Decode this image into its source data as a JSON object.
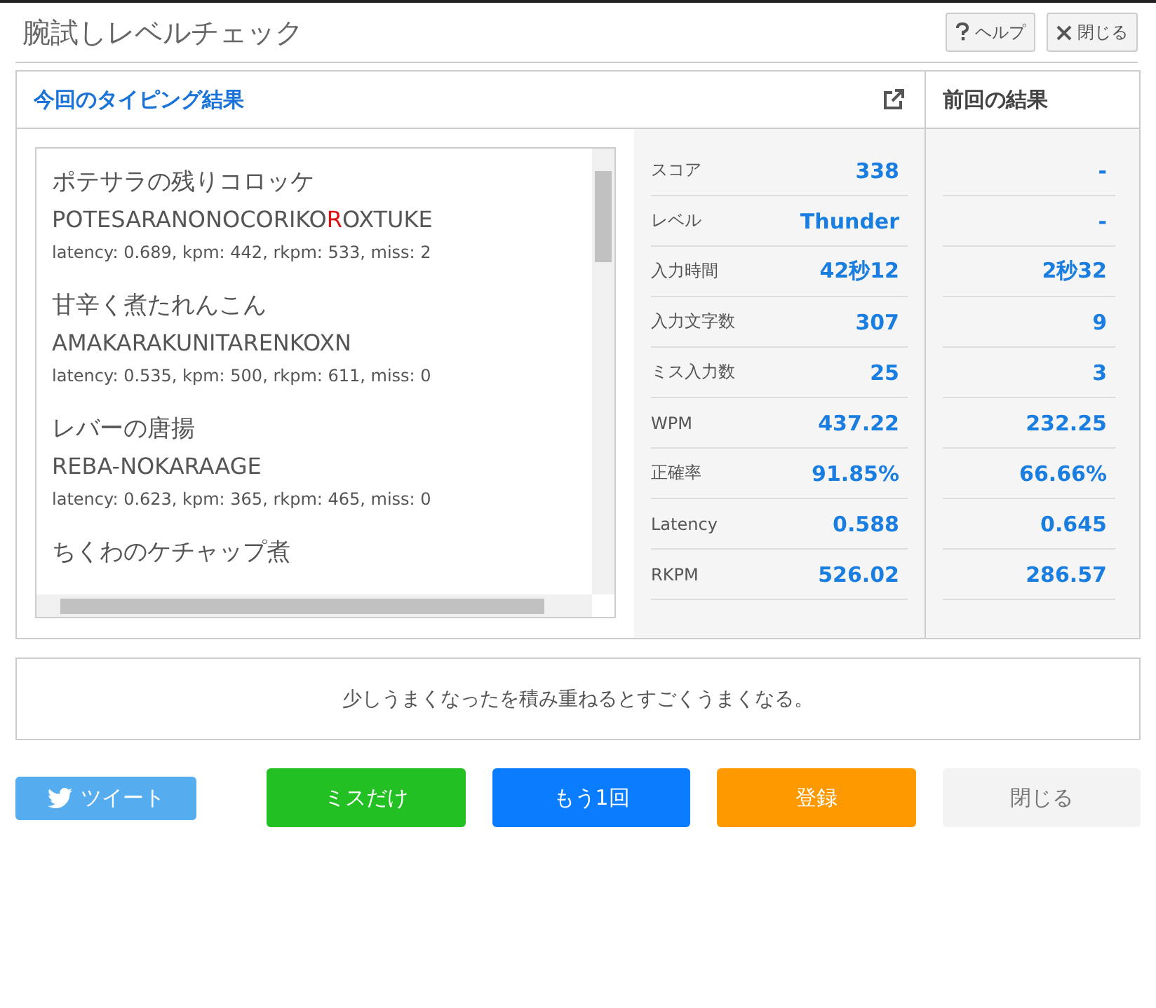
{
  "window": {
    "title": "腕試しレベルチェック",
    "buttons": [
      {
        "kind": "help",
        "label": "ヘルプ"
      },
      {
        "kind": "close",
        "label": "閉じる"
      }
    ]
  },
  "current": {
    "title": "今回のタイピング結果",
    "words": [
      {
        "title": "ポテサラの残りコロッケ",
        "romaji": [
          {
            "text": "POTESARANONOCORIKO",
            "miss": false
          },
          {
            "text": "R",
            "miss": true
          },
          {
            "text": "OXTUKE",
            "miss": false
          }
        ],
        "stats": "latency: 0.689, kpm: 442, rkpm: 533, miss: 2"
      },
      {
        "title": "甘辛く煮たれんこん",
        "romaji": [
          {
            "text": "AMAKARAKUNITARENKOXN",
            "miss": false
          }
        ],
        "stats": "latency: 0.535, kpm: 500, rkpm: 611, miss: 0"
      },
      {
        "title": "レバーの唐揚",
        "romaji": [
          {
            "text": "REBA-NOKARAAGE",
            "miss": false
          }
        ],
        "stats": "latency: 0.623, kpm: 365, rkpm: 465, miss: 0"
      },
      {
        "title": "ちくわのケチャップ煮"
      }
    ],
    "stats": [
      {
        "label": "スコア",
        "value": "338"
      },
      {
        "label": "レベル",
        "value": "Thunder"
      },
      {
        "label": "入力時間",
        "value": "42秒12"
      },
      {
        "label": "入力文字数",
        "value": "307"
      },
      {
        "label": "ミス入力数",
        "value": "25"
      },
      {
        "label": "WPM",
        "value": "437.22"
      },
      {
        "label": "正確率",
        "value": "91.85%"
      },
      {
        "label": "Latency",
        "value": "0.588"
      },
      {
        "label": "RKPM",
        "value": "526.02"
      }
    ]
  },
  "previous": {
    "title": "前回の結果",
    "values": [
      "-",
      "-",
      "2秒32",
      "9",
      "3",
      "232.25",
      "66.66%",
      "0.645",
      "286.57"
    ]
  },
  "message": "少しうまくなったを積み重ねるとすごくうまくなる。",
  "actions": [
    {
      "kind": "tweet",
      "label": "ツイート"
    },
    {
      "kind": "green",
      "label": "ミスだけ"
    },
    {
      "kind": "blue",
      "label": "もう1回"
    },
    {
      "kind": "orange",
      "label": "登録"
    },
    {
      "kind": "grey",
      "label": "閉じる"
    }
  ]
}
